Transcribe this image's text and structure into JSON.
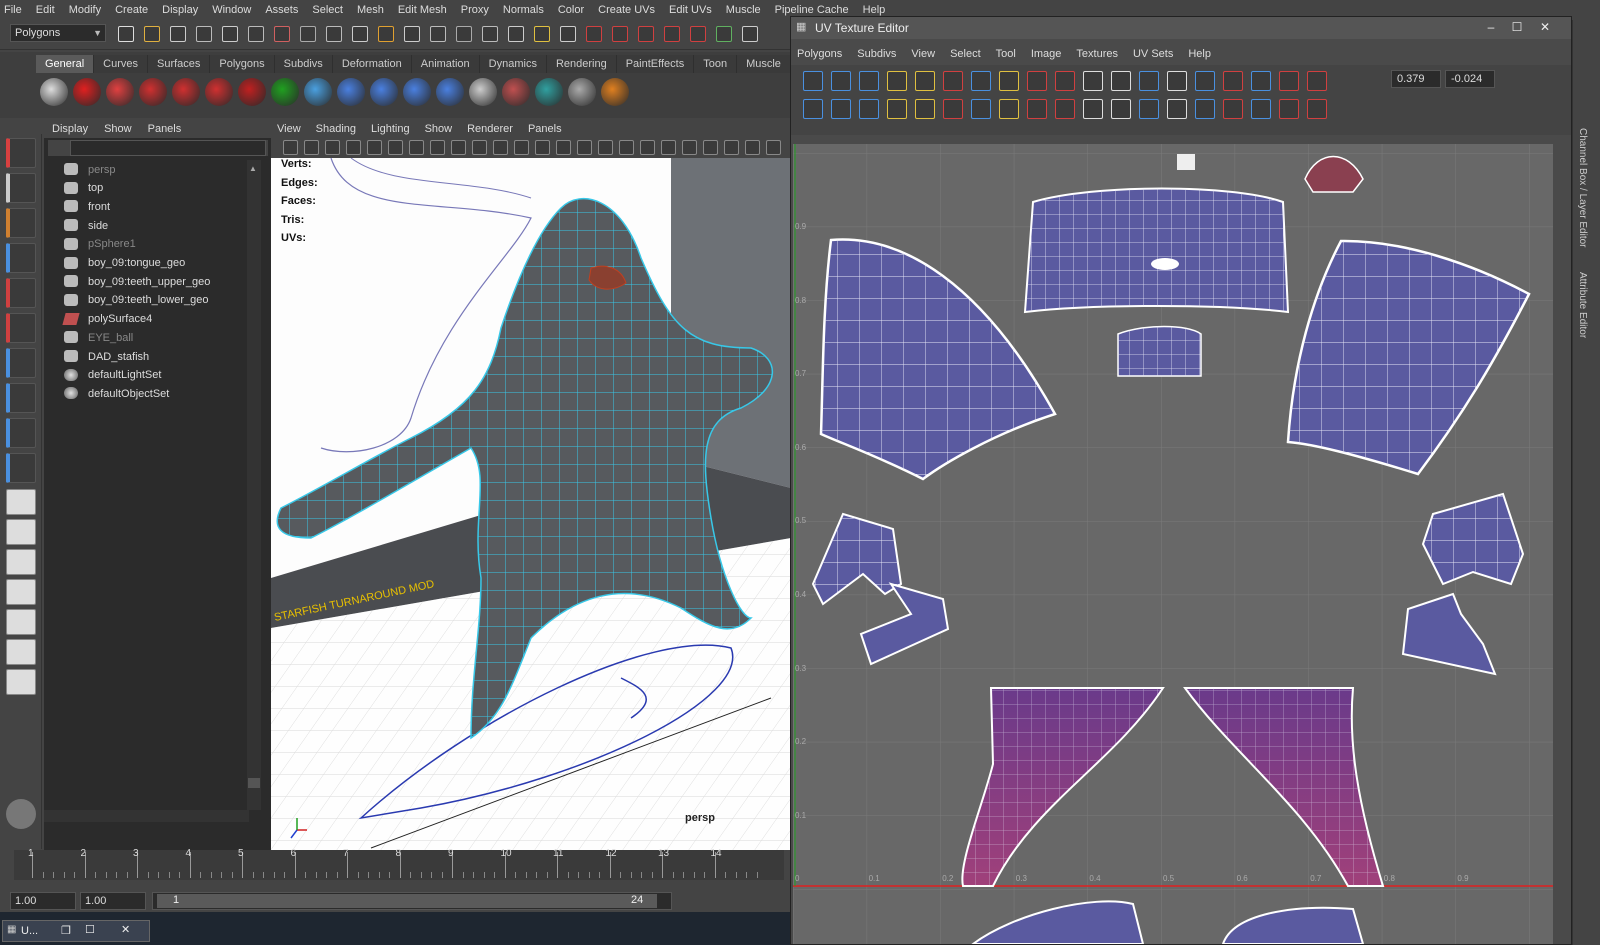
{
  "main_menu": [
    "File",
    "Edit",
    "Modify",
    "Create",
    "Display",
    "Window",
    "Assets",
    "Select",
    "Mesh",
    "Edit Mesh",
    "Proxy",
    "Normals",
    "Color",
    "Create UVs",
    "Edit UVs",
    "Muscle",
    "Pipeline Cache",
    "Help"
  ],
  "menu_set": "Polygons",
  "shelf_tabs": [
    "General",
    "Curves",
    "Surfaces",
    "Polygons",
    "Subdivs",
    "Deformation",
    "Animation",
    "Dynamics",
    "Rendering",
    "PaintEffects",
    "Toon",
    "Muscle"
  ],
  "shelf_active": "General",
  "outliner": {
    "menu": [
      "Display",
      "Show",
      "Panels"
    ],
    "items": [
      {
        "label": "persp",
        "dim": true
      },
      {
        "label": "top",
        "dim": false
      },
      {
        "label": "front",
        "dim": false
      },
      {
        "label": "side",
        "dim": false
      },
      {
        "label": "pSphere1",
        "dim": true
      },
      {
        "label": "boy_09:tongue_geo",
        "dim": false
      },
      {
        "label": "boy_09:teeth_upper_geo",
        "dim": false
      },
      {
        "label": "boy_09:teeth_lower_geo",
        "dim": false
      },
      {
        "label": "polySurface4",
        "dim": false
      },
      {
        "label": "EYE_ball",
        "dim": true
      },
      {
        "label": "DAD_stafish",
        "dim": false
      },
      {
        "label": "defaultLightSet",
        "dim": false
      },
      {
        "label": "defaultObjectSet",
        "dim": false
      }
    ]
  },
  "viewport": {
    "menu": [
      "View",
      "Shading",
      "Lighting",
      "Show",
      "Renderer",
      "Panels"
    ],
    "hud": [
      "Verts:",
      "Edges:",
      "Faces:",
      "Tris:",
      "UVs:"
    ],
    "camera": "persp",
    "floor_text": "STARFISH  TURNAROUND  MOD"
  },
  "timeline": {
    "ticks": [
      "1",
      "2",
      "3",
      "4",
      "5",
      "6",
      "7",
      "8",
      "9",
      "10",
      "11",
      "12",
      "13",
      "14"
    ],
    "start": "1.00",
    "playback_start": "1.00",
    "range_start": "1",
    "range_end": "24"
  },
  "taskbar": {
    "item": "U..."
  },
  "uv_editor": {
    "title": "UV Texture Editor",
    "menu": [
      "Polygons",
      "Subdivs",
      "View",
      "Select",
      "Tool",
      "Image",
      "Textures",
      "UV Sets",
      "Help"
    ],
    "u_value": "0.379",
    "v_value": "-0.024",
    "v_ticks": [
      "0.9",
      "0.8",
      "0.7",
      "0.6",
      "0.5",
      "0.4",
      "0.3",
      "0.2",
      "0.1"
    ],
    "u_ticks": [
      "0",
      "0.1",
      "0.2",
      "0.3",
      "0.4",
      "0.5",
      "0.6",
      "0.7",
      "0.8",
      "0.9"
    ]
  },
  "right_tabs": [
    "Channel Box / Layer Editor",
    "Attribute Editor"
  ],
  "colors": {
    "uv_blue": "#5a5aa0",
    "uv_pink": "#8a3a6a",
    "wire_cyan": "#38c8e8",
    "grid_bg": "#686868"
  }
}
